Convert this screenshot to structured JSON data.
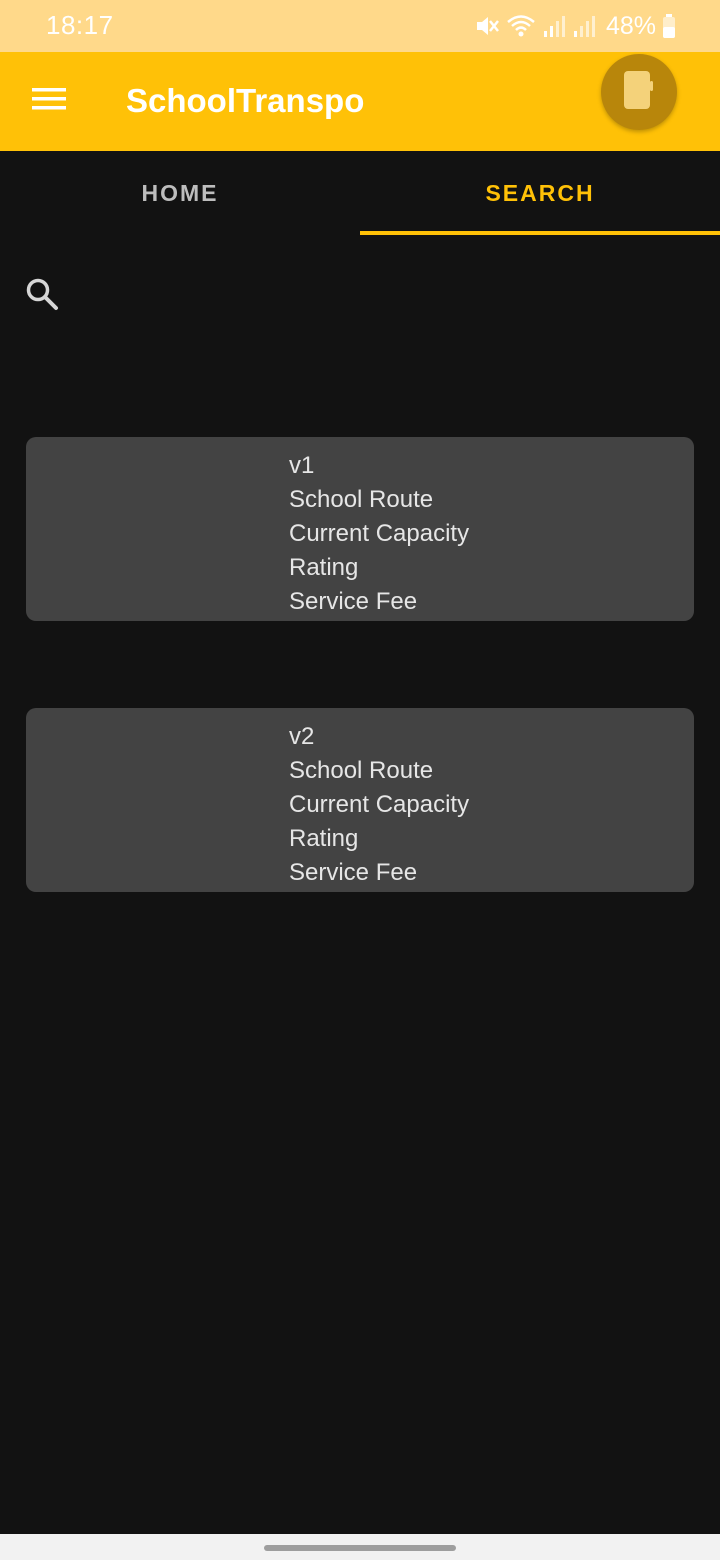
{
  "status_bar": {
    "time": "18:17",
    "battery": "48%",
    "icons": [
      "mute-icon",
      "wifi-icon",
      "signal-icon",
      "signal-icon",
      "battery-icon"
    ]
  },
  "app_bar": {
    "title": "SchoolTranspo",
    "menu_icon": "hamburger-menu-icon",
    "avatar_icon": "profile-icon",
    "background": "#FFC107"
  },
  "tabs": [
    {
      "label": "HOME",
      "selected": false
    },
    {
      "label": "SEARCH",
      "selected": true
    }
  ],
  "search": {
    "icon": "search-icon"
  },
  "cards": [
    {
      "name": "v1",
      "lines": [
        "School Route",
        "Current Capacity",
        "Rating",
        "Service Fee"
      ]
    },
    {
      "name": "v2",
      "lines": [
        "School Route",
        "Current Capacity",
        "Rating",
        "Service Fee"
      ]
    }
  ],
  "colors": {
    "accent": "#FFC107",
    "background": "#121212",
    "card": "#434343",
    "status_bar": "#FFD98A"
  }
}
